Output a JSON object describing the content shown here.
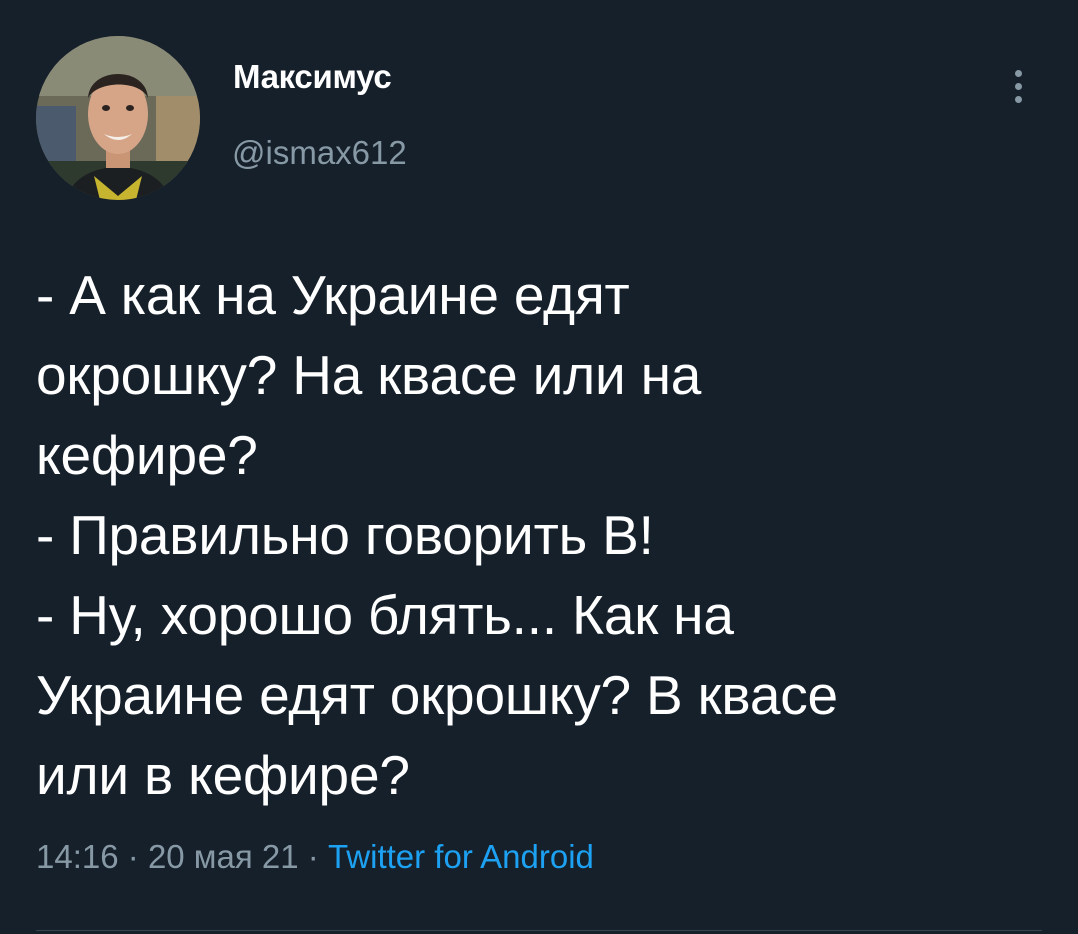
{
  "tweet": {
    "author": {
      "display_name": "Максимус",
      "handle": "@ismax612",
      "avatar": "profile-photo"
    },
    "more_icon": "more-vertical-icon",
    "text_lines": [
      "- А как на Украине едят",
      "окрошку? На квасе или на",
      "кефире?",
      "- Правильно говорить В!",
      "- Ну, хорошо блять... Как на",
      "Украине едят окрошку? В квасе",
      "или в кефире?"
    ],
    "meta": {
      "time": "14:16",
      "separator": "·",
      "date": "20 мая 21",
      "source": "Twitter for Android"
    }
  },
  "colors": {
    "background": "#15202b",
    "text_primary": "#ffffff",
    "text_secondary": "#8899a6",
    "link": "#1da1f2",
    "divider": "#38444d"
  }
}
